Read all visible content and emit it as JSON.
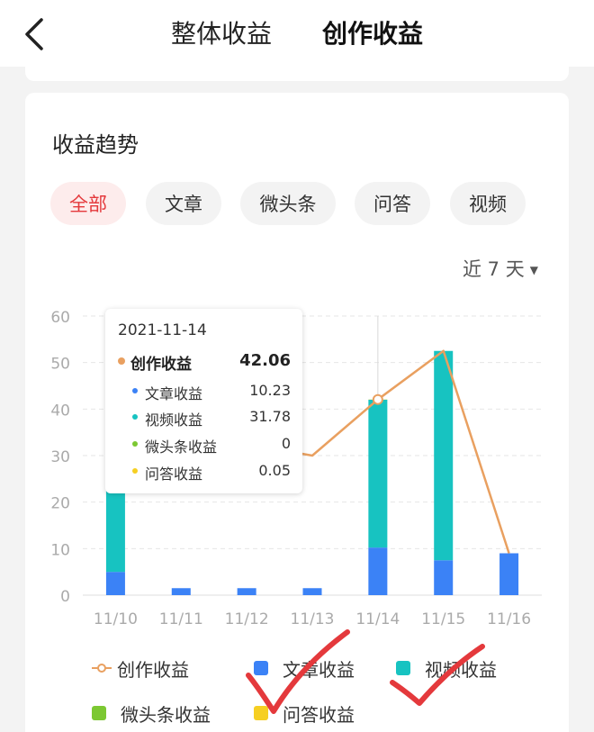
{
  "tabs": [
    {
      "label": "整体收益",
      "active": false
    },
    {
      "label": "创作收益",
      "active": true
    }
  ],
  "card": {
    "title": "收益趋势",
    "filters": [
      {
        "label": "全部",
        "active": true
      },
      {
        "label": "文章",
        "active": false
      },
      {
        "label": "微头条",
        "active": false
      },
      {
        "label": "问答",
        "active": false
      },
      {
        "label": "视频",
        "active": false
      }
    ],
    "range_label": "近 7 天"
  },
  "colors": {
    "accent": "#e4393c",
    "creation": "#e9a060",
    "article": "#3b82f6",
    "video": "#17c3c1",
    "micro": "#7cc832",
    "qa": "#f6cf22"
  },
  "chart_data": {
    "type": "bar",
    "categories": [
      "11/10",
      "11/11",
      "11/12",
      "11/13",
      "11/14",
      "11/15",
      "11/16"
    ],
    "ylim": [
      0,
      60
    ],
    "yticks": [
      0,
      10,
      20,
      30,
      40,
      50,
      60
    ],
    "grid": true,
    "stacked": true,
    "series": [
      {
        "name": "文章收益",
        "type": "bar",
        "color": "#3b82f6",
        "values": [
          5.0,
          1.5,
          1.5,
          1.5,
          10.23,
          7.5,
          9.0
        ]
      },
      {
        "name": "视频收益",
        "type": "bar",
        "color": "#17c3c1",
        "values": [
          32.5,
          null,
          null,
          null,
          31.78,
          45.0,
          0
        ]
      },
      {
        "name": "微头条收益",
        "type": "bar",
        "color": "#7cc832",
        "values": [
          0,
          0,
          0,
          0,
          0,
          0,
          0
        ]
      },
      {
        "name": "问答收益",
        "type": "bar",
        "color": "#f6cf22",
        "values": [
          0,
          0,
          0,
          0,
          0.05,
          0,
          0
        ]
      },
      {
        "name": "创作收益",
        "type": "line",
        "color": "#e9a060",
        "values": [
          37.5,
          null,
          null,
          30,
          42.06,
          52.5,
          9.0
        ]
      }
    ],
    "tooltip": {
      "date": "2021-11-14",
      "category_index": 4,
      "total_label": "创作收益",
      "total_value": "42.06",
      "items": [
        {
          "label": "文章收益",
          "value": "10.23",
          "color": "#3b82f6"
        },
        {
          "label": "视频收益",
          "value": "31.78",
          "color": "#17c3c1"
        },
        {
          "label": "微头条收益",
          "value": "0",
          "color": "#7cc832"
        },
        {
          "label": "问答收益",
          "value": "0.05",
          "color": "#f6cf22"
        }
      ]
    },
    "legend": [
      {
        "label": "创作收益",
        "kind": "line",
        "color": "#e9a060"
      },
      {
        "label": "文章收益",
        "kind": "square",
        "color": "#3b82f6"
      },
      {
        "label": "视频收益",
        "kind": "square",
        "color": "#17c3c1"
      },
      {
        "label": "微头条收益",
        "kind": "square",
        "color": "#7cc832"
      },
      {
        "label": "问答收益",
        "kind": "square",
        "color": "#f6cf22"
      }
    ]
  },
  "annotations": [
    {
      "kind": "red-checkmark",
      "color": "#e4393c"
    },
    {
      "kind": "red-checkmark",
      "color": "#e4393c"
    }
  ]
}
